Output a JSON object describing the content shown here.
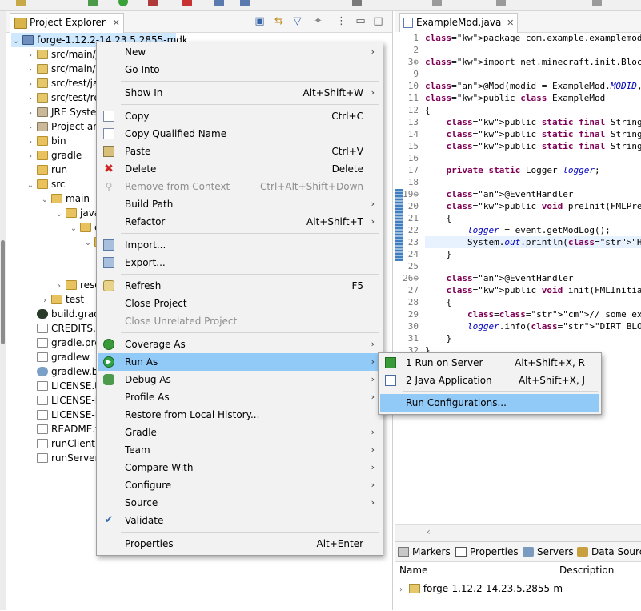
{
  "project_explorer": {
    "tab_title": "Project Explorer",
    "tree": [
      {
        "label": "forge-1.12.2-14.23.5.2855-mdk"
      },
      {
        "label": "src/main/j"
      },
      {
        "label": "src/main/r"
      },
      {
        "label": "src/test/ja"
      },
      {
        "label": "src/test/re"
      },
      {
        "label": "JRE Systen"
      },
      {
        "label": "Project an"
      },
      {
        "label": "bin"
      },
      {
        "label": "gradle"
      },
      {
        "label": "run"
      },
      {
        "label": "src"
      },
      {
        "label": "main"
      },
      {
        "label": "java"
      },
      {
        "label": "c"
      },
      {
        "label": ""
      },
      {
        "label": ""
      },
      {
        "label": "reso"
      },
      {
        "label": "test"
      },
      {
        "label": "build.grad"
      },
      {
        "label": "CREDITS.t"
      },
      {
        "label": "gradle.pro"
      },
      {
        "label": "gradlew"
      },
      {
        "label": "gradlew.ba"
      },
      {
        "label": "LICENSE.tx"
      },
      {
        "label": "LICENSE-P"
      },
      {
        "label": "LICENSE-P"
      },
      {
        "label": "README.t"
      },
      {
        "label": "runClient.l"
      },
      {
        "label": "runServer."
      }
    ]
  },
  "editor": {
    "tab_title": "ExampleMod.java",
    "lines": [
      {
        "num": "1",
        "text": "package com.example.examplemod;"
      },
      {
        "num": "2",
        "text": ""
      },
      {
        "num": "3⊕",
        "text": "import net.minecraft.init.Blocks;□"
      },
      {
        "num": "9",
        "text": ""
      },
      {
        "num": "10",
        "text": "@Mod(modid = ExampleMod.MODID, name = E"
      },
      {
        "num": "11",
        "text": "public class ExampleMod"
      },
      {
        "num": "12",
        "text": "{"
      },
      {
        "num": "13",
        "text": "    public static final String MODID = "
      },
      {
        "num": "14",
        "text": "    public static final String NAME = '"
      },
      {
        "num": "15",
        "text": "    public static final String VERSION"
      },
      {
        "num": "16",
        "text": ""
      },
      {
        "num": "17",
        "text": "    private static Logger logger;"
      },
      {
        "num": "18",
        "text": ""
      },
      {
        "num": "19⊖",
        "text": "    @EventHandler"
      },
      {
        "num": "20",
        "text": "    public void preInit(FMLPreInitializa"
      },
      {
        "num": "21",
        "text": "    {"
      },
      {
        "num": "22",
        "text": "        logger = event.getModLog();"
      },
      {
        "num": "23",
        "text": "        System.out.println(\"HEllo!!!!!!"
      },
      {
        "num": "24",
        "text": "    }"
      },
      {
        "num": "25",
        "text": ""
      },
      {
        "num": "26⊖",
        "text": "    @EventHandler"
      },
      {
        "num": "27",
        "text": "    public void init(FMLInitializationE"
      },
      {
        "num": "28",
        "text": "    {"
      },
      {
        "num": "29",
        "text": "        // some example code"
      },
      {
        "num": "30",
        "text": "        logger.info(\"DIRT BLOCK >> {}\","
      },
      {
        "num": "31",
        "text": "    }"
      },
      {
        "num": "32",
        "text": "}"
      }
    ]
  },
  "context_menu": {
    "items": [
      {
        "label": "New",
        "accel": "",
        "submenu": true
      },
      {
        "label": "Go Into",
        "accel": "",
        "submenu": false
      },
      {
        "label": "Show In",
        "accel": "Alt+Shift+W",
        "submenu": true
      },
      {
        "label": "Copy",
        "accel": "Ctrl+C",
        "submenu": false
      },
      {
        "label": "Copy Qualified Name",
        "accel": "",
        "submenu": false
      },
      {
        "label": "Paste",
        "accel": "Ctrl+V",
        "submenu": false
      },
      {
        "label": "Delete",
        "accel": "Delete",
        "submenu": false
      },
      {
        "label": "Remove from Context",
        "accel": "Ctrl+Alt+Shift+Down",
        "submenu": false
      },
      {
        "label": "Build Path",
        "accel": "",
        "submenu": true
      },
      {
        "label": "Refactor",
        "accel": "Alt+Shift+T",
        "submenu": true
      },
      {
        "label": "Import...",
        "accel": "",
        "submenu": false
      },
      {
        "label": "Export...",
        "accel": "",
        "submenu": false
      },
      {
        "label": "Refresh",
        "accel": "F5",
        "submenu": false
      },
      {
        "label": "Close Project",
        "accel": "",
        "submenu": false
      },
      {
        "label": "Close Unrelated Project",
        "accel": "",
        "submenu": false
      },
      {
        "label": "Coverage As",
        "accel": "",
        "submenu": true
      },
      {
        "label": "Run As",
        "accel": "",
        "submenu": true
      },
      {
        "label": "Debug As",
        "accel": "",
        "submenu": true
      },
      {
        "label": "Profile As",
        "accel": "",
        "submenu": true
      },
      {
        "label": "Restore from Local History...",
        "accel": "",
        "submenu": false
      },
      {
        "label": "Gradle",
        "accel": "",
        "submenu": true
      },
      {
        "label": "Team",
        "accel": "",
        "submenu": true
      },
      {
        "label": "Compare With",
        "accel": "",
        "submenu": true
      },
      {
        "label": "Configure",
        "accel": "",
        "submenu": true
      },
      {
        "label": "Source",
        "accel": "",
        "submenu": true
      },
      {
        "label": "Validate",
        "accel": "",
        "submenu": false
      },
      {
        "label": "Properties",
        "accel": "Alt+Enter",
        "submenu": false
      }
    ],
    "arrow": "›"
  },
  "run_as_submenu": {
    "items": [
      {
        "label": "1 Run on Server",
        "accel": "Alt+Shift+X, R"
      },
      {
        "label": "2 Java Application",
        "accel": "Alt+Shift+X, J"
      },
      {
        "label": "Run Configurations...",
        "accel": ""
      }
    ]
  },
  "bottom_panel": {
    "tabs": [
      {
        "label": "Markers"
      },
      {
        "label": "Properties"
      },
      {
        "label": "Servers"
      },
      {
        "label": "Data Source"
      }
    ],
    "columns": {
      "name": "Name",
      "description": "Description"
    },
    "row": {
      "label": "forge-1.12.2-14.23.5.2855-m"
    }
  },
  "colors": {
    "menu_highlight": "#91c9f7",
    "selection": "#cde8ff",
    "keyword": "#7f0055",
    "string": "#2a00ff",
    "comment": "#3f7f5f"
  }
}
